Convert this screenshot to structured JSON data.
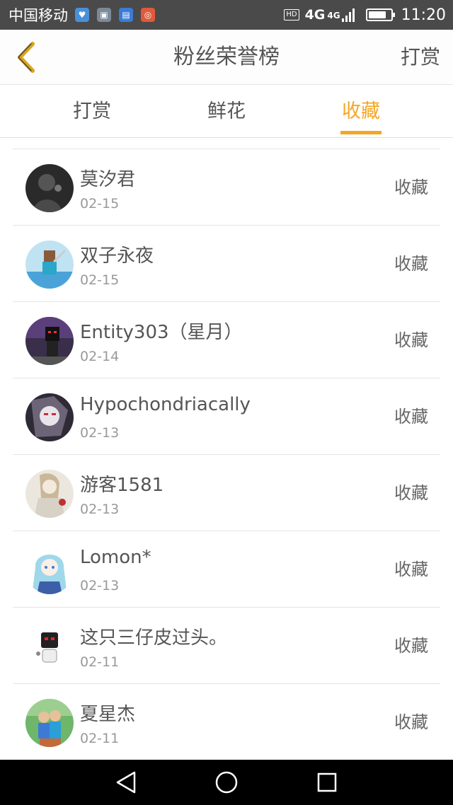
{
  "status_bar": {
    "carrier": "中国移动",
    "hd": "HD",
    "network_primary": "4G",
    "network_secondary": "4G",
    "time": "11:20",
    "battery_level": 0.8,
    "notification_icons": [
      "health-icon",
      "gallery-icon",
      "app-icon",
      "compass-icon"
    ]
  },
  "header": {
    "back_icon": "chevron-left-icon",
    "title": "粉丝荣誉榜",
    "action_label": "打赏"
  },
  "tabs": [
    {
      "label": "打赏",
      "active": false
    },
    {
      "label": "鲜花",
      "active": false
    },
    {
      "label": "收藏",
      "active": true
    }
  ],
  "colors": {
    "accent": "#f5a623",
    "text_primary": "#555555",
    "text_secondary": "#999999",
    "status_bar_bg": "#4a4a4a",
    "nav_bar_bg": "#000000"
  },
  "fans": [
    {
      "name": "莫汐君",
      "date": "02-15",
      "action": "收藏"
    },
    {
      "name": "双子永夜",
      "date": "02-15",
      "action": "收藏"
    },
    {
      "name": "Entity303（星月）",
      "date": "02-14",
      "action": "收藏"
    },
    {
      "name": "Hypochondriacally",
      "date": "02-13",
      "action": "收藏"
    },
    {
      "name": "游客1581",
      "date": "02-13",
      "action": "收藏"
    },
    {
      "name": "Lomon*",
      "date": "02-13",
      "action": "收藏"
    },
    {
      "name": "这只三仔皮过头。",
      "date": "02-11",
      "action": "收藏"
    },
    {
      "name": "夏星杰",
      "date": "02-11",
      "action": "收藏"
    }
  ],
  "nav_bar": {
    "icons": [
      "back-triangle-icon",
      "home-circle-icon",
      "recents-square-icon"
    ]
  }
}
